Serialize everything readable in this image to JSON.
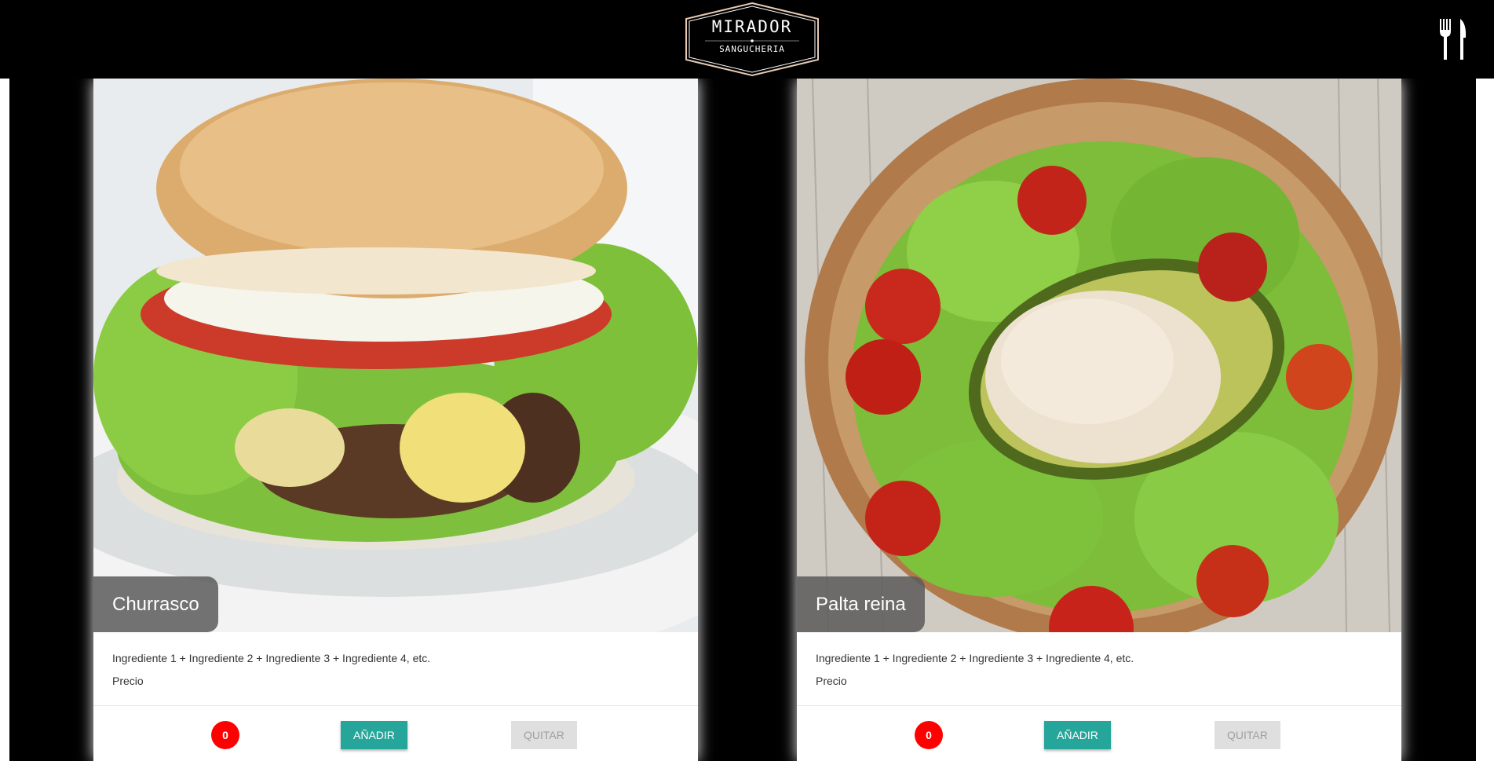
{
  "header": {
    "logo_title": "MIRADOR",
    "logo_subtitle": "SANGUCHERIA",
    "menu_icon": "fork-knife-icon"
  },
  "products": [
    {
      "name": "Churrasco",
      "description": "Ingrediente 1 + Ingrediente 2 + Ingrediente 3 + Ingrediente 4, etc.",
      "price_label": "Precio",
      "count": "0",
      "add_label": "AÑADIR",
      "remove_label": "QUITAR"
    },
    {
      "name": "Palta reina",
      "description": "Ingrediente 1 + Ingrediente 2 + Ingrediente 3 + Ingrediente 4, etc.",
      "price_label": "Precio",
      "count": "0",
      "add_label": "AÑADIR",
      "remove_label": "QUITAR"
    }
  ],
  "colors": {
    "accent": "#26a69a",
    "badge": "#ff0000",
    "disabled": "#dfdfdf"
  }
}
